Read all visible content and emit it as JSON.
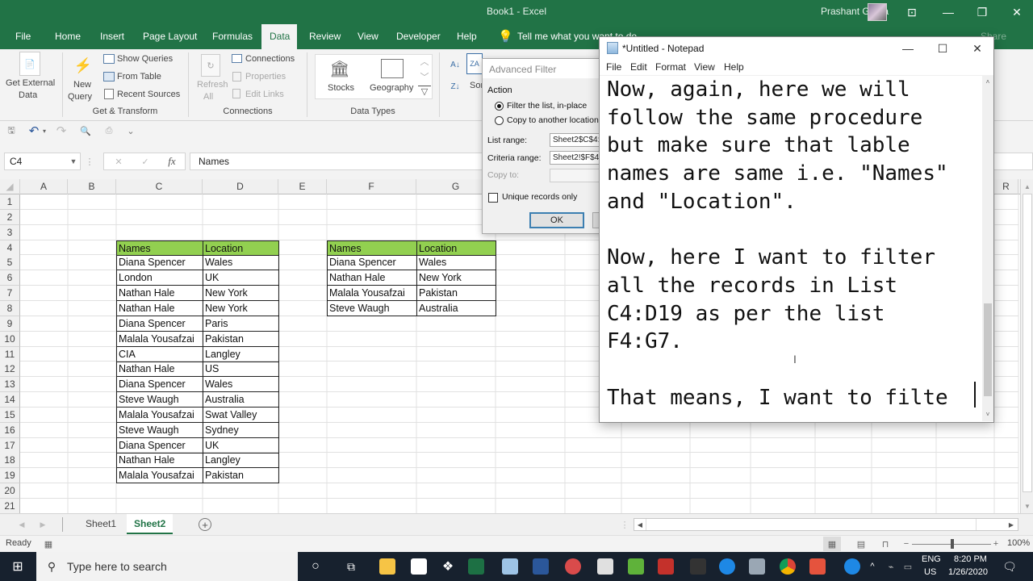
{
  "window": {
    "title": "Book1  -  Excel",
    "user": "Prashant Gupta",
    "controls": [
      "ribbon-display",
      "minimize",
      "restore",
      "close"
    ]
  },
  "ribbon": {
    "tabs": [
      "File",
      "Home",
      "Insert",
      "Page Layout",
      "Formulas",
      "Data",
      "Review",
      "View",
      "Developer",
      "Help"
    ],
    "active_tab": "Data",
    "tell_me": "Tell me what you want to do",
    "share": "Share",
    "groups": {
      "get_external": {
        "label1": "Get External",
        "label2": "Data"
      },
      "get_transform": {
        "label": "Get & Transform",
        "new_query1": "New",
        "new_query2": "Query",
        "show_queries": "Show Queries",
        "from_table": "From Table",
        "recent_sources": "Recent Sources"
      },
      "connections": {
        "label": "Connections",
        "refresh1": "Refresh",
        "refresh2": "All",
        "connections": "Connections",
        "properties": "Properties",
        "edit_links": "Edit Links"
      },
      "data_types": {
        "label": "Data Types",
        "stocks": "Stocks",
        "geography": "Geography"
      },
      "sort": {
        "sort_label": "Sort"
      }
    }
  },
  "formula_bar": {
    "name_box": "C4",
    "fx": "fx",
    "formula": "Names"
  },
  "columns": [
    "A",
    "B",
    "C",
    "D",
    "E",
    "F",
    "G",
    "R"
  ],
  "rows": [
    "1",
    "2",
    "3",
    "4",
    "5",
    "6",
    "7",
    "8",
    "9",
    "10",
    "11",
    "12",
    "13",
    "14",
    "15",
    "16",
    "17",
    "18",
    "19",
    "20",
    "21"
  ],
  "list_table": {
    "headers": [
      "Names",
      "Location"
    ],
    "rows": [
      [
        "Diana Spencer",
        "Wales"
      ],
      [
        "London",
        "UK"
      ],
      [
        "Nathan Hale",
        "New York"
      ],
      [
        "Nathan Hale",
        "New York"
      ],
      [
        "Diana Spencer",
        "Paris"
      ],
      [
        "Malala Yousafzai",
        "Pakistan"
      ],
      [
        "CIA",
        "Langley"
      ],
      [
        "Nathan Hale",
        "US"
      ],
      [
        "Diana Spencer",
        "Wales"
      ],
      [
        "Steve Waugh",
        "Australia"
      ],
      [
        "Malala Yousafzai",
        "Swat Valley"
      ],
      [
        "Steve Waugh",
        "Sydney"
      ],
      [
        "Diana Spencer",
        "UK"
      ],
      [
        "Nathan Hale",
        "Langley"
      ],
      [
        "Malala Yousafzai",
        "Pakistan"
      ]
    ]
  },
  "criteria_table": {
    "headers": [
      "Names",
      "Location"
    ],
    "rows": [
      [
        "Diana Spencer",
        "Wales"
      ],
      [
        "Nathan Hale",
        "New York"
      ],
      [
        "Malala Yousafzai",
        "Pakistan"
      ],
      [
        "Steve Waugh",
        "Australia"
      ]
    ]
  },
  "header_color": "#92d050",
  "dialog": {
    "title": "Advanced Filter",
    "action_label": "Action",
    "option1": "Filter the list, in-place",
    "option2": "Copy to another location",
    "selected": "option1",
    "list_range_label": "List range:",
    "list_range_value": "Sheet2$C$4:",
    "criteria_range_label": "Criteria range:",
    "criteria_range_value": "Sheet2!$F$4",
    "copy_to_label": "Copy to:",
    "copy_to_value": "",
    "unique_label": "Unique records only",
    "unique_checked": false,
    "ok": "OK"
  },
  "notepad": {
    "title": "*Untitled - Notepad",
    "menu": [
      "File",
      "Edit",
      "Format",
      "View",
      "Help"
    ],
    "text": "Now, again, here we will\nfollow the same procedure\nbut make sure that lable\nnames are same i.e. \"Names\"\nand \"Location\".\n\nNow, here I want to filter\nall the records in List\nC4:D19 as per the list\nF4:G7.\n\nThat means, I want to filte"
  },
  "sheets": [
    "Sheet1",
    "Sheet2"
  ],
  "active_sheet": "Sheet2",
  "status": {
    "ready": "Ready",
    "zoom": "100%"
  },
  "taskbar": {
    "search_placeholder": "Type here to search",
    "time": "8:20 PM",
    "date": "1/26/2020",
    "lang1": "ENG",
    "lang2": "US"
  }
}
